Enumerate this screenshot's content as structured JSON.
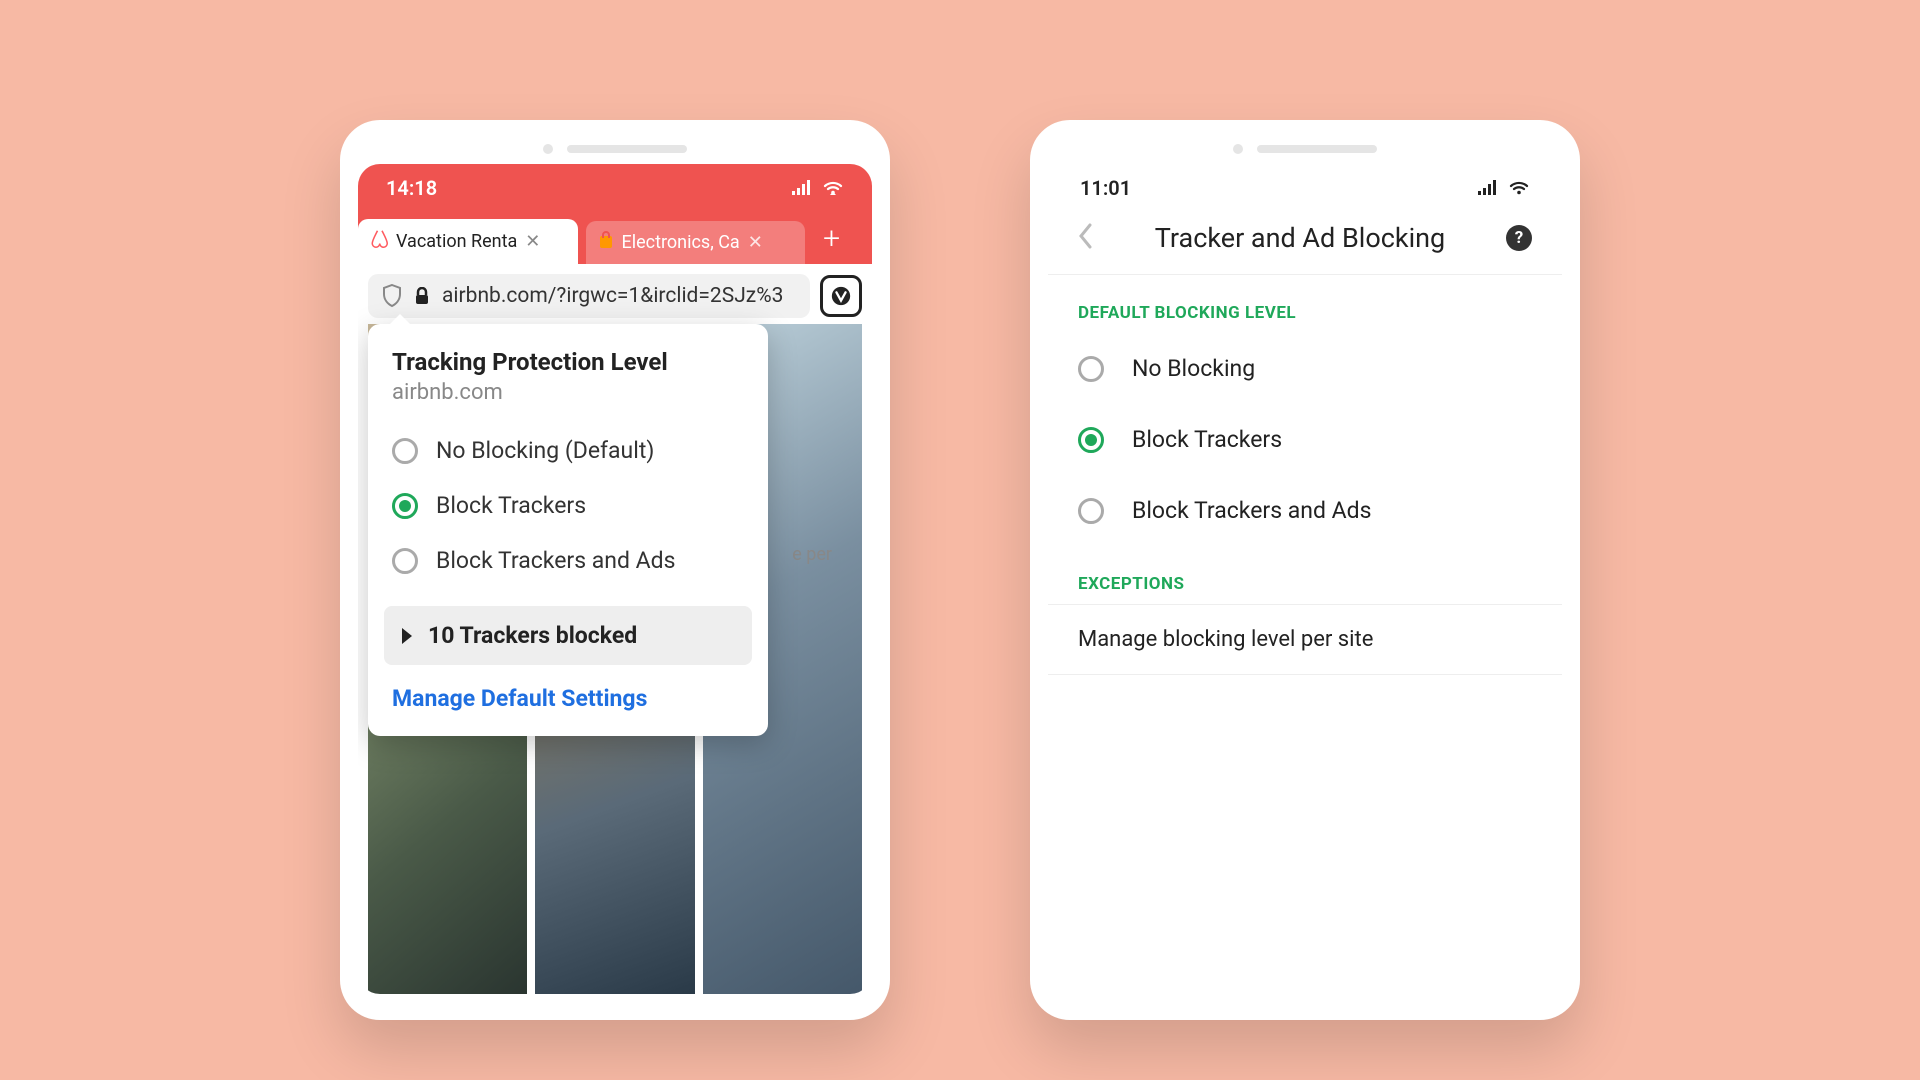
{
  "phone1": {
    "status": {
      "time": "14:18"
    },
    "tabs": {
      "active": {
        "title": "Vacation Renta"
      },
      "inactive": {
        "title": "Electronics, Ca"
      }
    },
    "address": {
      "url": "airbnb.com/?irgwc=1&irclid=2SJz%3"
    },
    "content_hint": "e per",
    "popover": {
      "title": "Tracking Protection Level",
      "site": "airbnb.com",
      "options": {
        "none": "No Blocking (Default)",
        "trackers": "Block Trackers",
        "all": "Block Trackers and Ads"
      },
      "blocked": "10 Trackers blocked",
      "manage_link": "Manage Default Settings"
    }
  },
  "phone2": {
    "status": {
      "time": "11:01"
    },
    "title": "Tracker and Ad Blocking",
    "sections": {
      "default_level": "DEFAULT BLOCKING LEVEL",
      "exceptions": "EXCEPTIONS"
    },
    "options": {
      "none": "No Blocking",
      "trackers": "Block Trackers",
      "all": "Block Trackers and Ads"
    },
    "manage_per_site": "Manage blocking level per site"
  }
}
